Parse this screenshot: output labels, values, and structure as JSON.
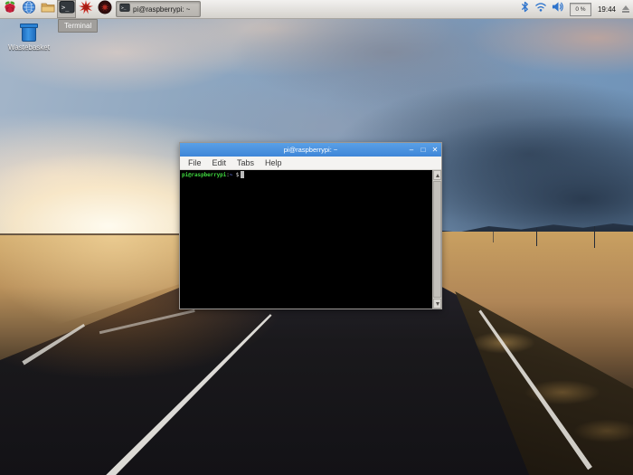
{
  "taskbar": {
    "launchers": [
      {
        "name": "menu",
        "icon": "raspberry-icon"
      },
      {
        "name": "web-browser",
        "icon": "globe-icon"
      },
      {
        "name": "file-manager",
        "icon": "folder-icon"
      },
      {
        "name": "terminal",
        "icon": "terminal-icon",
        "tooltip": "Terminal"
      },
      {
        "name": "mathematica",
        "icon": "mathematica-icon"
      },
      {
        "name": "wolfram",
        "icon": "wolfram-icon"
      }
    ],
    "window_button": {
      "label": "pi@raspberrypi: ~"
    },
    "tooltip_text": "Terminal",
    "status": {
      "cpu_label": "0 %",
      "clock": "19:44"
    }
  },
  "desktop": {
    "wastebasket_label": "Wastebasket"
  },
  "window": {
    "title": "pi@raspberrypi: ~",
    "controls": {
      "minimize": "–",
      "maximize": "□",
      "close": "✕"
    },
    "menu_items": [
      "File",
      "Edit",
      "Tabs",
      "Help"
    ],
    "terminal": {
      "user_host": "pi@raspberrypi",
      "separator": ":",
      "path": "~",
      "prompt_symbol": " $"
    }
  },
  "colors": {
    "titlebar_blue": "#4a90d9",
    "prompt_green": "#3ed43e",
    "prompt_blue": "#6b7ff0",
    "terminal_bg": "#000000",
    "taskbar_gray": "#d5d2cd"
  }
}
